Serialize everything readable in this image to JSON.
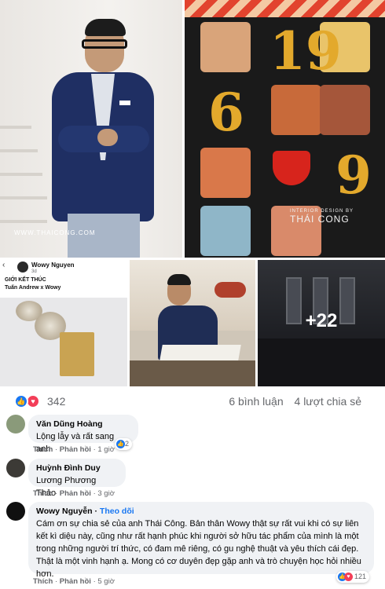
{
  "photos": {
    "watermark": "WWW.THAICONG.COM",
    "poster": {
      "digits": [
        "19",
        "6",
        "9"
      ],
      "credit_small": "INTERIOR DESIGN BY",
      "credit_big": "THÁI CONG"
    },
    "fb_crop": {
      "author": "Wowy Nguyen",
      "time": "3d",
      "title": "GIỚI KẾT THÚC",
      "subtitle": "Tuấn Andrew x Wowy"
    },
    "more_count": "+22"
  },
  "reactions": {
    "count": "342",
    "comments": "6 bình luận",
    "shares": "4 lượt chia sẻ",
    "colors": {
      "like": "#1877f2",
      "love": "#f33e58"
    }
  },
  "comments": [
    {
      "name": "Văn Dũng Hoàng",
      "text": "Lộng lẫy và rất sang anh",
      "like": "Thích",
      "reply": "Phản hồi",
      "time": "1 giờ",
      "reaction_count": "2"
    },
    {
      "name": "Huỳnh Đình Duy",
      "text": "Lương Phương Thảo",
      "like": "Thích",
      "reply": "Phản hồi",
      "time": "3 giờ"
    },
    {
      "name": "Wowy Nguyễn",
      "follow": "Theo dõi",
      "text": "Cám ơn sự chia sẻ của anh Thái Công. Bản thân Wowy thật sự rất vui khi có sự liên kết kì diệu này, cũng như rất hạnh phúc khi người sở hữu tác phẩm của mình là một trong những người trí thức, có đam mê riêng, có gu nghệ thuật và yêu thích cái đẹp. Thật là một vinh hạnh ạ. Mong có cơ duyên đẹp gặp anh và trò chuyện học hỏi nhiều hơn.",
      "like": "Thích",
      "reply": "Phản hồi",
      "time": "5 giờ",
      "reaction_count": "121"
    }
  ]
}
